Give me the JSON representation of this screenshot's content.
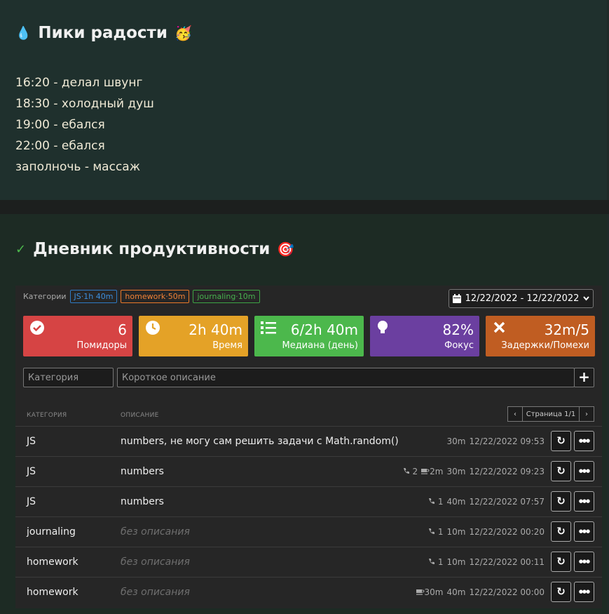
{
  "joy": {
    "icon": "💧",
    "title": "Пики радости",
    "emoji": "🥳",
    "lines": [
      "16:20 - делал швунг",
      "18:30 - холодный душ",
      "19:00 - ебался",
      "22:00 - ебался",
      "заполночь - массаж"
    ]
  },
  "diary": {
    "icon": "✓",
    "title": "Дневник продуктивности",
    "emoji": "🎯"
  },
  "filters": {
    "label": "Категории",
    "tags": [
      {
        "text": "JS·1h 40m",
        "color": "#3c8edc"
      },
      {
        "text": "homework·50m",
        "color": "#ef8136"
      },
      {
        "text": "journaling·10m",
        "color": "#48b04f"
      }
    ]
  },
  "date_range": "12/22/2022 - 12/22/2022",
  "stats": [
    {
      "value": "6",
      "label": "Помидоры",
      "icon": "check-circle-icon",
      "color": "#d64444"
    },
    {
      "value": "2h 40m",
      "label": "Время",
      "icon": "clock-icon",
      "color": "#e4a227"
    },
    {
      "value": "6/2h 40m",
      "label": "Медиана (день)",
      "icon": "list-icon",
      "color": "#4cb84c"
    },
    {
      "value": "82%",
      "label": "Фокус",
      "icon": "lightbulb-icon",
      "color": "#6b3fa0"
    },
    {
      "value": "32m/5",
      "label": "Задержки/Помехи",
      "icon": "close-icon",
      "color": "#c05d22"
    }
  ],
  "form": {
    "category_placeholder": "Категория",
    "description_placeholder": "Короткое описание",
    "add": "+"
  },
  "table": {
    "col_category": "КАТЕГОРИЯ",
    "col_description": "ОПИСАНИЕ",
    "page": "Страница 1/1",
    "rows": [
      {
        "category": "JS",
        "description": "numbers, не могу сам решить задачи с Math.random()",
        "empty": false,
        "calls": "",
        "breaks": "",
        "duration": "30m",
        "datetime": "12/22/2022 09:53"
      },
      {
        "category": "JS",
        "description": "numbers",
        "empty": false,
        "calls": "2",
        "breaks": "2m",
        "duration": "30m",
        "datetime": "12/22/2022 09:23"
      },
      {
        "category": "JS",
        "description": "numbers",
        "empty": false,
        "calls": "1",
        "breaks": "",
        "duration": "40m",
        "datetime": "12/22/2022 07:57"
      },
      {
        "category": "journaling",
        "description": "без описания",
        "empty": true,
        "calls": "1",
        "breaks": "",
        "duration": "10m",
        "datetime": "12/22/2022 00:20"
      },
      {
        "category": "homework",
        "description": "без описания",
        "empty": true,
        "calls": "1",
        "breaks": "",
        "duration": "10m",
        "datetime": "12/22/2022 00:11"
      },
      {
        "category": "homework",
        "description": "без описания",
        "empty": true,
        "calls": "",
        "breaks": "30m",
        "duration": "40m",
        "datetime": "12/22/2022 00:00"
      }
    ]
  }
}
